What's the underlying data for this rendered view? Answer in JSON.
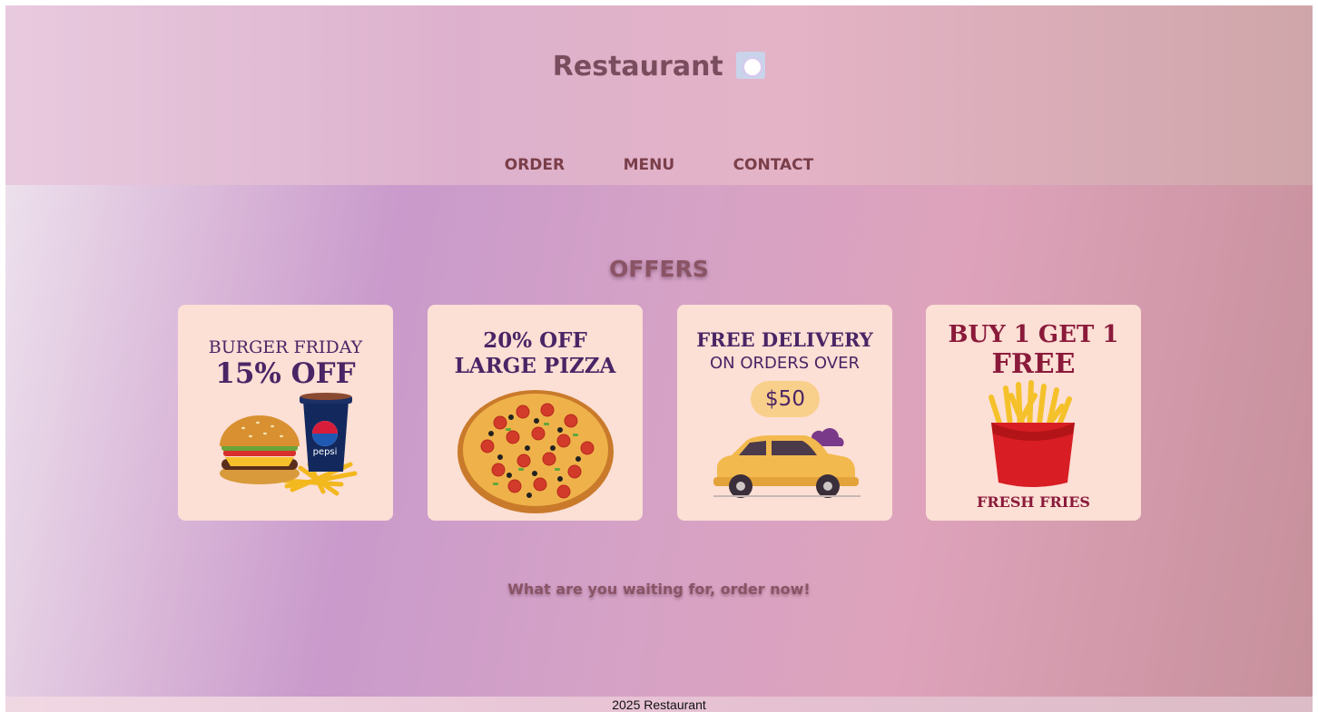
{
  "header": {
    "brand": "Restaurant",
    "brand_icon": "plate-cutlery-icon",
    "nav": [
      {
        "label": "ORDER"
      },
      {
        "label": "MENU"
      },
      {
        "label": "CONTACT"
      }
    ]
  },
  "offers": {
    "title": "OFFERS",
    "cards": [
      {
        "line1": "BURGER FRIDAY",
        "line2": "15% OFF",
        "image": "burger-fries-pepsi-image",
        "cup_text": "pepsi"
      },
      {
        "line1": "20% OFF",
        "line2": "LARGE PIZZA",
        "image": "pizza-image"
      },
      {
        "line1": "FREE DELIVERY",
        "line2": "ON ORDERS OVER",
        "badge": "$50",
        "image": "delivery-car-image"
      },
      {
        "line1": "BUY 1 GET 1",
        "line2": "FREE",
        "caption": "FRESH FRIES",
        "image": "fries-image"
      }
    ]
  },
  "cta": "What are you waiting for, order now!",
  "footer": "2025 Restaurant",
  "colors": {
    "card_bg": "#fcdfd5",
    "nav_text": "#7a3f4a",
    "brand_text": "#7a4d5e",
    "card_title_purple": "#4a2565",
    "card_title_wine": "#8a1a3a"
  }
}
